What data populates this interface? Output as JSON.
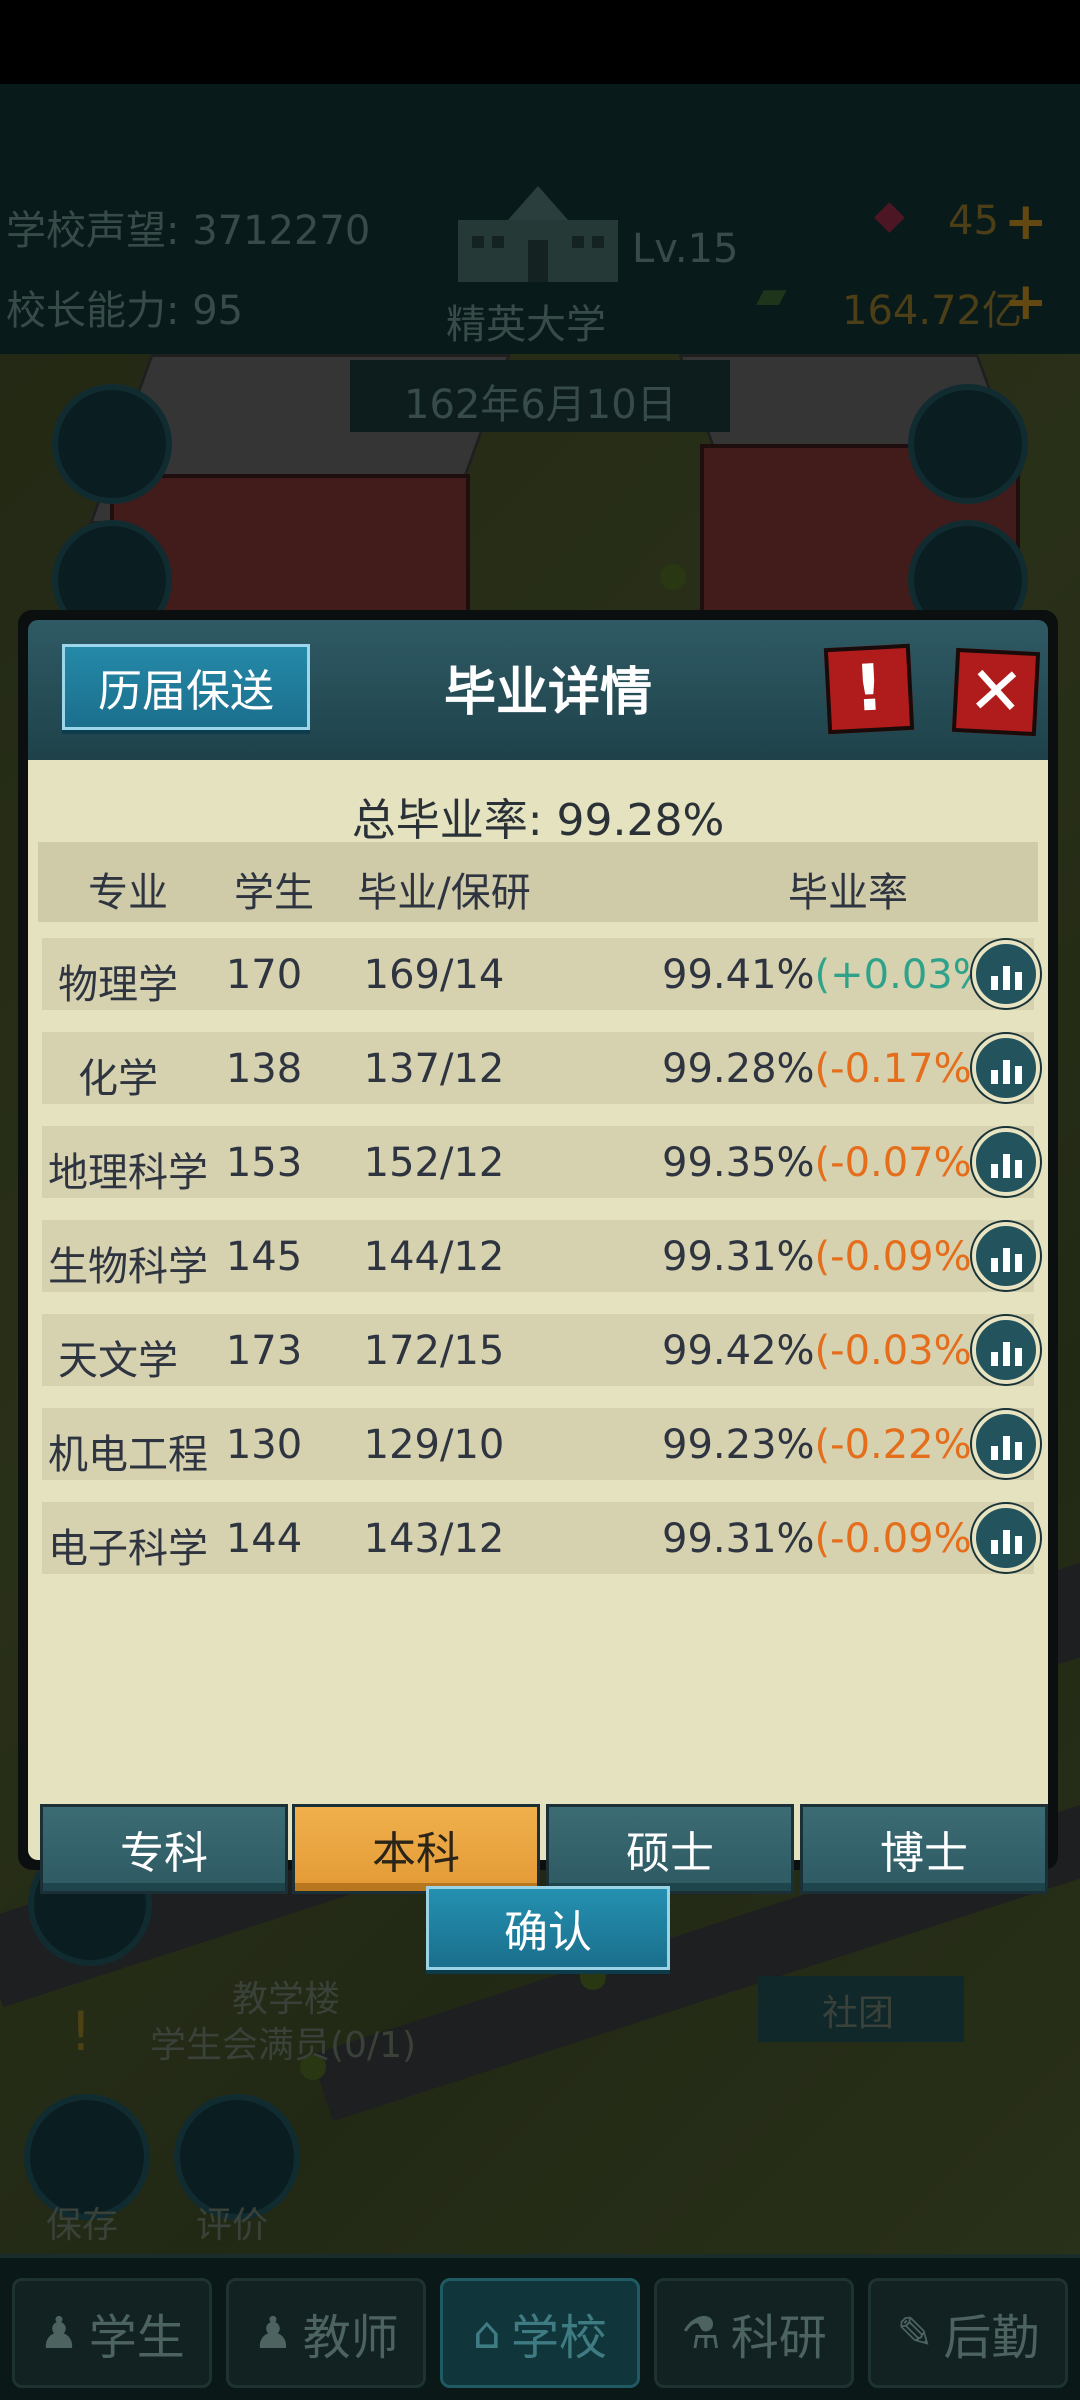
{
  "hud": {
    "reputation_label": "学校声望: 3712270",
    "principal_label": "校长能力: 95",
    "school_name": "精英大学",
    "level": "Lv.15",
    "gems": "45",
    "money": "164.72亿",
    "date": "162年6月10日"
  },
  "scene": {
    "teaching_building": "教学楼",
    "club": "社团",
    "task": "学生会满员(0/1)",
    "save": "保存",
    "review": "评价"
  },
  "nav": {
    "tabs": [
      {
        "label": "学生",
        "icon": "student-icon"
      },
      {
        "label": "教师",
        "icon": "teacher-icon"
      },
      {
        "label": "学校",
        "icon": "school-icon"
      },
      {
        "label": "科研",
        "icon": "research-icon"
      },
      {
        "label": "后勤",
        "icon": "logistics-icon"
      }
    ],
    "active": "学校"
  },
  "dialog": {
    "history_button": "历届保送",
    "title": "毕业详情",
    "warn_icon": "exclamation-icon",
    "close_icon": "close-icon",
    "total_rate": "总毕业率: 99.28%",
    "headers": [
      "专业",
      "学生",
      "毕业/保研",
      "毕业率"
    ],
    "rows": [
      {
        "major": "物理学",
        "students": "170",
        "grad": "169/14",
        "rate": "99.41%",
        "delta": "(+0.03%)",
        "trend": "up"
      },
      {
        "major": "化学",
        "students": "138",
        "grad": "137/12",
        "rate": "99.28%",
        "delta": "(-0.17%)",
        "trend": "down"
      },
      {
        "major": "地理科学",
        "students": "153",
        "grad": "152/12",
        "rate": "99.35%",
        "delta": "(-0.07%)",
        "trend": "down"
      },
      {
        "major": "生物科学",
        "students": "145",
        "grad": "144/12",
        "rate": "99.31%",
        "delta": "(-0.09%)",
        "trend": "down"
      },
      {
        "major": "天文学",
        "students": "173",
        "grad": "172/15",
        "rate": "99.42%",
        "delta": "(-0.03%)",
        "trend": "down"
      },
      {
        "major": "机电工程",
        "students": "130",
        "grad": "129/10",
        "rate": "99.23%",
        "delta": "(-0.22%)",
        "trend": "down"
      },
      {
        "major": "电子科学",
        "students": "144",
        "grad": "143/12",
        "rate": "99.31%",
        "delta": "(-0.09%)",
        "trend": "down"
      }
    ],
    "degree_tabs": [
      "专科",
      "本科",
      "硕士",
      "博士"
    ],
    "active_degree": "本科",
    "confirm_button": "确认",
    "colors": {
      "delta_up": "#2fa38a",
      "delta_down": "#e46e1b",
      "active_tab": "#e39a35"
    }
  }
}
